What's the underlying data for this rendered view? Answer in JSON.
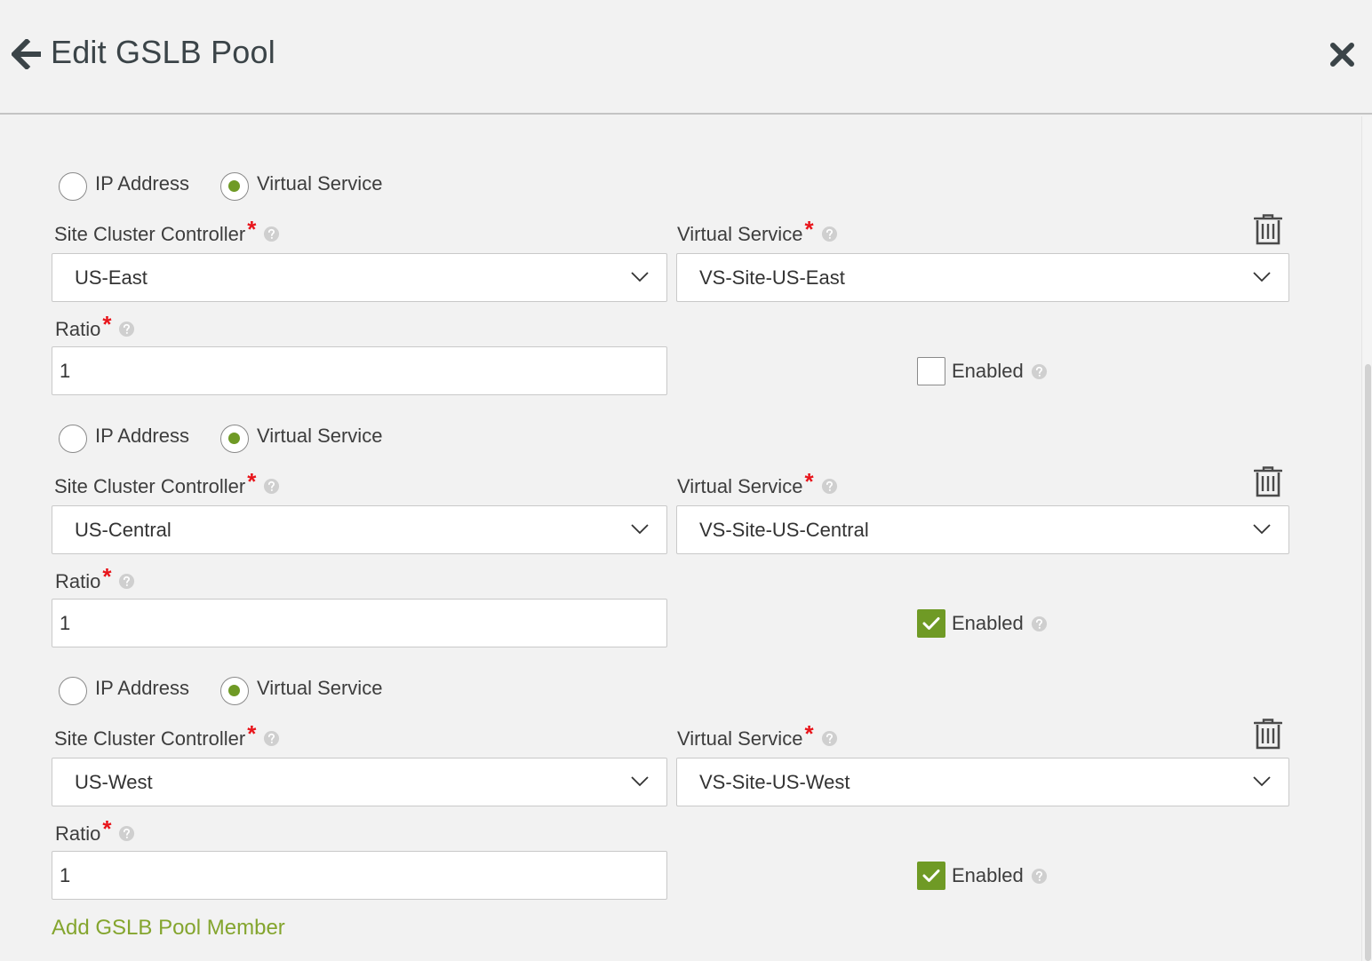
{
  "header": {
    "title": "Edit GSLB Pool"
  },
  "labels": {
    "ip_address": "IP Address",
    "virtual_service_option": "Virtual Service",
    "site_cluster_controller": "Site Cluster Controller",
    "virtual_service_field": "Virtual Service",
    "ratio": "Ratio",
    "required_marker": "*",
    "enabled": "Enabled"
  },
  "members": [
    {
      "type": "Virtual Service",
      "site_cluster_controller": "US-East",
      "virtual_service": "VS-Site-US-East",
      "ratio": "1",
      "enabled": false
    },
    {
      "type": "Virtual Service",
      "site_cluster_controller": "US-Central",
      "virtual_service": "VS-Site-US-Central",
      "ratio": "1",
      "enabled": true
    },
    {
      "type": "Virtual Service",
      "site_cluster_controller": "US-West",
      "virtual_service": "VS-Site-US-West",
      "ratio": "1",
      "enabled": true
    }
  ],
  "add_member_label": "Add GSLB Pool Member",
  "colors": {
    "accent_green": "#6f9a25",
    "link_green": "#84a52e",
    "required_red": "#e8151b",
    "background": "#f2f2f2"
  },
  "icons": {
    "back": "arrow-left-icon",
    "close": "close-icon",
    "help": "question-circle-icon",
    "dropdown": "chevron-down-icon",
    "delete": "trash-icon",
    "check": "check-icon"
  }
}
